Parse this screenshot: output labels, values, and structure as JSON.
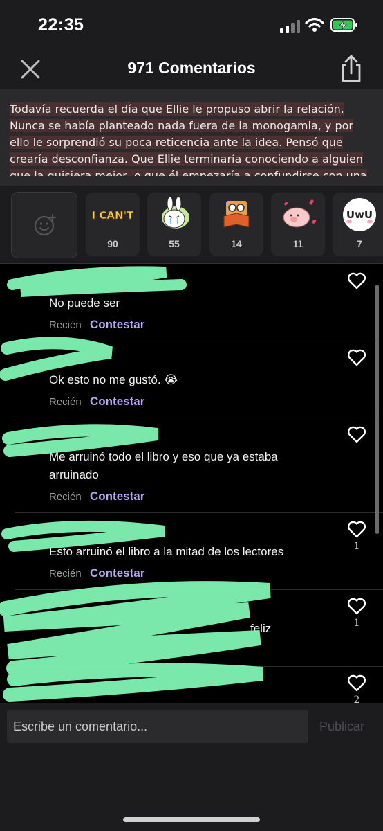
{
  "status_bar": {
    "time": "22:35"
  },
  "header": {
    "title": "971 Comentarios"
  },
  "excerpt": {
    "text": "Todavía recuerda el día que Ellie le propuso abrir la relación. Nunca se había planteado nada fuera de la monogamia, y por ello le sorprendió su poca reticencia ante la idea. Pensó que crearía desconfianza. Que Ellie terminaría conociendo a alguien que la quisiera mejor, o que él empezaría a confundirse con una chica con"
  },
  "reactions": [
    {
      "name": "i-cant-sticker",
      "caption": "I CAN'T",
      "count": "90"
    },
    {
      "name": "crying-bunny-sticker",
      "count": "55"
    },
    {
      "name": "glasses-book-sticker",
      "count": "14"
    },
    {
      "name": "pig-hearts-sticker",
      "count": "11"
    },
    {
      "name": "uwu-sticker",
      "caption": "UwU",
      "count": "7"
    }
  ],
  "comments": [
    {
      "text": "No puede ser",
      "time": "Recién",
      "reply": "Contestar",
      "likes": ""
    },
    {
      "text": "Ok esto no me gustó. 😭",
      "time": "Recién",
      "reply": "Contestar",
      "likes": ""
    },
    {
      "text": "Me arruinó todo el libro y eso que ya estaba arruinado",
      "time": "Recién",
      "reply": "Contestar",
      "likes": ""
    },
    {
      "text": "Esto arruinó el libro a la mitad de los lectores",
      "time": "Recién",
      "reply": "Contestar",
      "likes": "1"
    },
    {
      "text": "feliz",
      "time": "",
      "reply": "",
      "likes": "1"
    },
    {
      "text": "",
      "time": "",
      "reply": "",
      "likes": "2"
    }
  ],
  "composer": {
    "placeholder": "Escribe un comentario...",
    "publish_label": "Publicar"
  },
  "colors": {
    "accent": "#b7a7f2",
    "scribble": "#7ff2b1",
    "background": "#000000",
    "panel": "#1c1c1e"
  }
}
